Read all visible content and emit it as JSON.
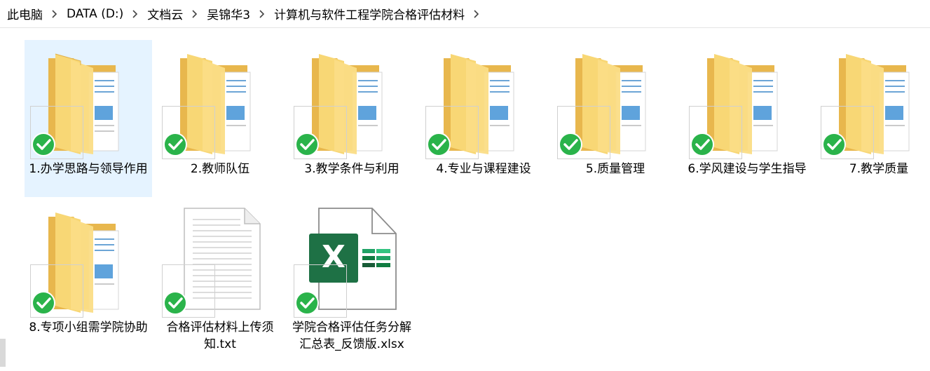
{
  "breadcrumb": {
    "items": [
      "此电脑",
      "DATA (D:)",
      "文档云",
      "吴锦华3",
      "计算机与软件工程学院合格评估材料"
    ]
  },
  "items": [
    {
      "label": "1.办学思路与领导作用",
      "type": "folder",
      "synced": true,
      "selected": true
    },
    {
      "label": "2.教师队伍",
      "type": "folder",
      "synced": true,
      "selected": false
    },
    {
      "label": "3.教学条件与利用",
      "type": "folder",
      "synced": true,
      "selected": false
    },
    {
      "label": "4.专业与课程建设",
      "type": "folder",
      "synced": true,
      "selected": false
    },
    {
      "label": "5.质量管理",
      "type": "folder",
      "synced": true,
      "selected": false
    },
    {
      "label": "6.学风建设与学生指导",
      "type": "folder",
      "synced": true,
      "selected": false
    },
    {
      "label": "7.教学质量",
      "type": "folder",
      "synced": true,
      "selected": false
    },
    {
      "label": "8.专项小组需学院协助",
      "type": "folder",
      "synced": true,
      "selected": false
    },
    {
      "label": "合格评估材料上传须知.txt",
      "type": "txt",
      "synced": true,
      "selected": false
    },
    {
      "label": "学院合格评估任务分解汇总表_反馈版.xlsx",
      "type": "xlsx",
      "synced": true,
      "selected": false
    }
  ],
  "colors": {
    "folder_back": "#e8b74d",
    "folder_front": "#f8d775",
    "selected_bg": "#e5f3ff",
    "check_green": "#2ab34a",
    "excel_green": "#1e7145"
  },
  "icons": {
    "separator": "chevron-right-icon",
    "sync": "sync-check-icon",
    "folder": "folder-icon",
    "txt": "text-file-icon",
    "xlsx": "excel-file-icon"
  }
}
